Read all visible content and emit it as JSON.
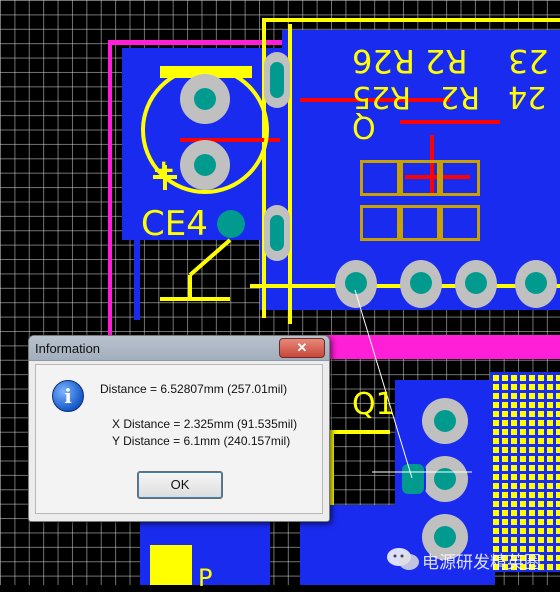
{
  "pcb": {
    "silkscreen": {
      "ce4": "CE4",
      "q1": "Q1",
      "r26": "R26",
      "r25": "R25",
      "r2": "R2",
      "r2_2": "R2",
      "d23": "23",
      "d24": "24",
      "dq": "Q",
      "dp": "P",
      "plus": "+"
    }
  },
  "dialog": {
    "title": "Information",
    "close": "✕",
    "distance": "Distance = 6.52807mm (257.01mil)",
    "x_distance": "X Distance = 2.325mm (91.535mil)",
    "y_distance": "Y Distance = 6.1mm (240.157mil)",
    "ok": "OK"
  },
  "watermark": {
    "text": "电源研发精英圈"
  },
  "colors": {
    "top_layer": "#1a2bf0",
    "bottom_layer": "#ff1fd6",
    "silkscreen": "#ffff00",
    "copper": "#ff0000",
    "pad": "#c0c0c0",
    "hole": "#009a8f"
  }
}
